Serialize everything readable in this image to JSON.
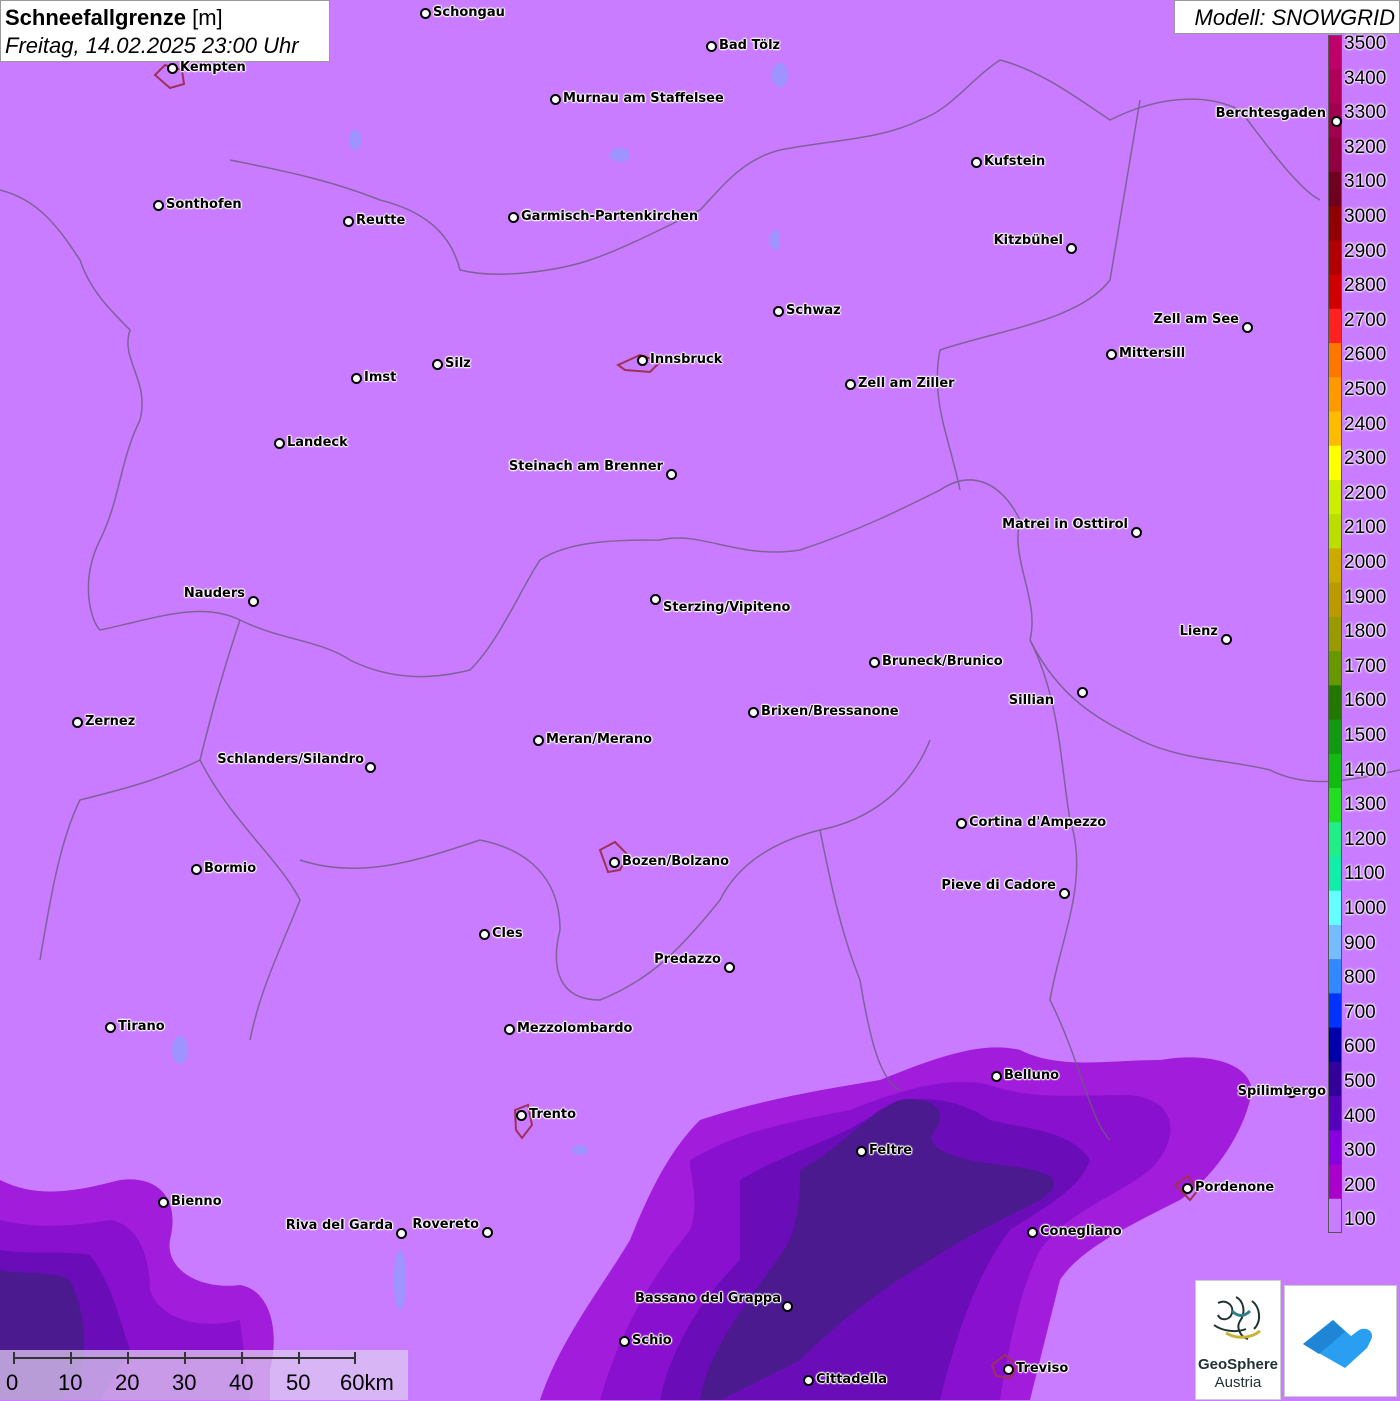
{
  "title": {
    "bold": "Schneefallgrenze",
    "unit": "[m]",
    "datetime": "Freitag, 14.02.2025 23:00 Uhr"
  },
  "model": "Modell: SNOWGRID",
  "legend": {
    "labels": [
      "3500",
      "3400",
      "3300",
      "3200",
      "3100",
      "3000",
      "2900",
      "2800",
      "2700",
      "2600",
      "2500",
      "2400",
      "2300",
      "2200",
      "2100",
      "2000",
      "1900",
      "1800",
      "1700",
      "1600",
      "1500",
      "1400",
      "1300",
      "1200",
      "1100",
      "1000",
      "900",
      "800",
      "700",
      "600",
      "500",
      "400",
      "300",
      "200",
      "100"
    ],
    "colors": [
      "#c0006a",
      "#b0005a",
      "#a0004e",
      "#900040",
      "#700020",
      "#900000",
      "#b00000",
      "#d00000",
      "#ff2020",
      "#ff7700",
      "#ff9900",
      "#ffbb00",
      "#ffff00",
      "#ccee00",
      "#bbdd00",
      "#ccaa00",
      "#bb9900",
      "#999900",
      "#669900",
      "#227700",
      "#119911",
      "#11bb11",
      "#22dd22",
      "#22ee88",
      "#11eeaa",
      "#66ffff",
      "#77bbff",
      "#3388ff",
      "#0033ff",
      "#0000aa",
      "#330099",
      "#5500bb",
      "#8800dd",
      "#aa00cc",
      "#c97cff"
    ]
  },
  "cities": [
    {
      "name": "Schongau"
    },
    {
      "name": "Bad Tölz"
    },
    {
      "name": "Kempten"
    },
    {
      "name": "Murnau am Staffelsee"
    },
    {
      "name": "Berchtesgaden"
    },
    {
      "name": "Kufstein"
    },
    {
      "name": "Sonthofen"
    },
    {
      "name": "Reutte"
    },
    {
      "name": "Garmisch-Partenkirchen"
    },
    {
      "name": "Kitzbühel"
    },
    {
      "name": "Schwaz"
    },
    {
      "name": "Zell am See"
    },
    {
      "name": "Innsbruck"
    },
    {
      "name": "Mittersill"
    },
    {
      "name": "Silz"
    },
    {
      "name": "Imst"
    },
    {
      "name": "Zell am Ziller"
    },
    {
      "name": "Landeck"
    },
    {
      "name": "Steinach am Brenner"
    },
    {
      "name": "Matrei in Osttirol"
    },
    {
      "name": "Nauders"
    },
    {
      "name": "Sterzing/Vipiteno"
    },
    {
      "name": "Lienz"
    },
    {
      "name": "Bruneck/Brunico"
    },
    {
      "name": "Sillian"
    },
    {
      "name": "Zernez"
    },
    {
      "name": "Brixen/Bressanone"
    },
    {
      "name": "Meran/Merano"
    },
    {
      "name": "Schlanders/Silandro"
    },
    {
      "name": "Cortina d'Ampezzo"
    },
    {
      "name": "Bozen/Bolzano"
    },
    {
      "name": "Bormio"
    },
    {
      "name": "Pieve di Cadore"
    },
    {
      "name": "Cles"
    },
    {
      "name": "Predazzo"
    },
    {
      "name": "Tirano"
    },
    {
      "name": "Mezzolombardo"
    },
    {
      "name": "Belluno"
    },
    {
      "name": "Spilimbergo"
    },
    {
      "name": "Trento"
    },
    {
      "name": "Feltre"
    },
    {
      "name": "Pordenone"
    },
    {
      "name": "Bienno"
    },
    {
      "name": "Riva del Garda"
    },
    {
      "name": "Rovereto"
    },
    {
      "name": "Conegliano"
    },
    {
      "name": "Bassano del Grappa"
    },
    {
      "name": "Schio"
    },
    {
      "name": "Treviso"
    },
    {
      "name": "Cittadella"
    }
  ],
  "scale": {
    "labels": [
      "0",
      "10",
      "20",
      "30",
      "40",
      "50",
      "60km"
    ]
  },
  "logo": {
    "name": "GeoSphere",
    "sub": "Austria"
  }
}
